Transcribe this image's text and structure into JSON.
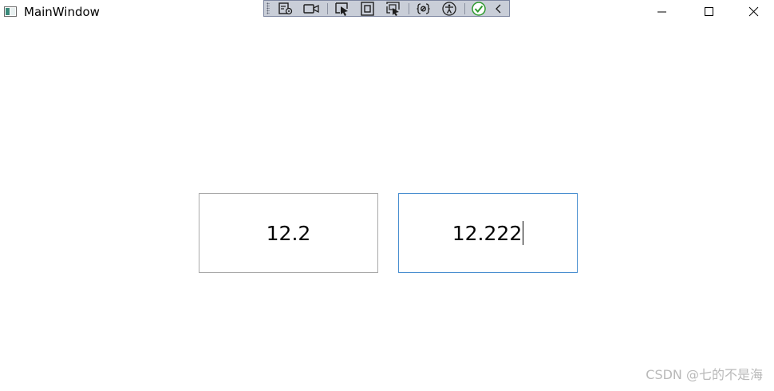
{
  "window": {
    "title": "MainWindow",
    "icon": "app-window-icon",
    "controls": {
      "minimize_icon": "minimize-icon",
      "maximize_icon": "maximize-icon",
      "close_icon": "close-icon"
    }
  },
  "debug_toolbar": {
    "items": [
      "live-visual-tree-icon",
      "record-icon",
      "select-element-icon",
      "display-adorners-icon",
      "track-focus-icon",
      "binding-failures-icon",
      "accessibility-icon",
      "hot-reload-ok-icon",
      "collapse-icon"
    ],
    "accent_color": "#2e9a2e"
  },
  "main": {
    "left_field": {
      "value": "12.2"
    },
    "right_field": {
      "value": "12.222",
      "focused": true
    }
  },
  "watermark": {
    "text": "CSDN @七的不是海"
  }
}
